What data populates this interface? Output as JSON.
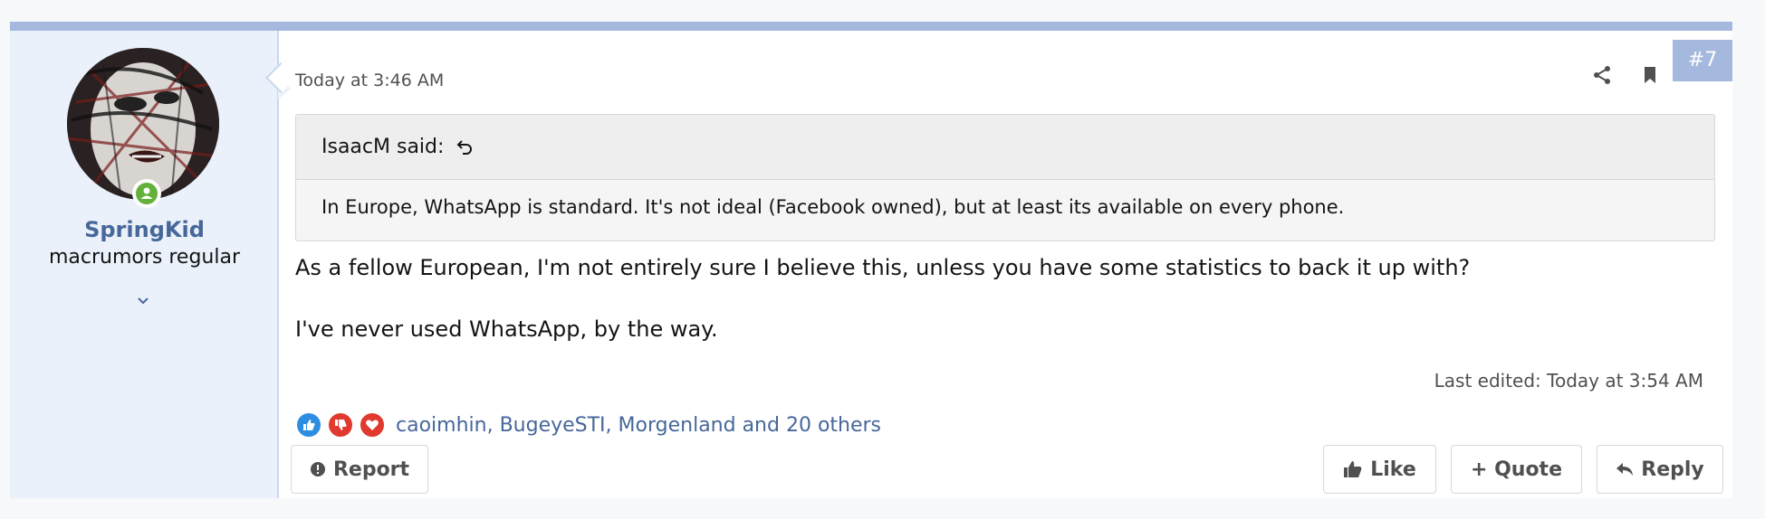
{
  "post": {
    "number": "#7",
    "date": "Today at 3:46 AM",
    "user": {
      "name": "SpringKid",
      "title": "macrumors regular"
    },
    "quote": {
      "author_label": "IsaacM said:",
      "text": "In Europe, WhatsApp is standard. It's not ideal (Facebook owned), but at least its available on every phone."
    },
    "message": {
      "paragraph_1": "As a fellow European, I'm not entirely sure I believe this, unless you have some statistics to back it up with?",
      "paragraph_2": "I've never used WhatsApp, by the way."
    },
    "last_edited": "Last edited: Today at 3:54 AM",
    "reactions": {
      "icons": [
        "thumbs-up-icon",
        "thumbs-down-icon",
        "heart-icon"
      ],
      "users_text": "caoimhin, BugeyeSTI, Morgenland and 20 others"
    },
    "actions": {
      "report": "Report",
      "like": "Like",
      "quote": "+ Quote",
      "reply": "Reply"
    }
  },
  "colors": {
    "accent": "#a5b9de",
    "username": "#47679a",
    "online": "#63b13a",
    "user_cell_bg": "#eaf1fa"
  }
}
